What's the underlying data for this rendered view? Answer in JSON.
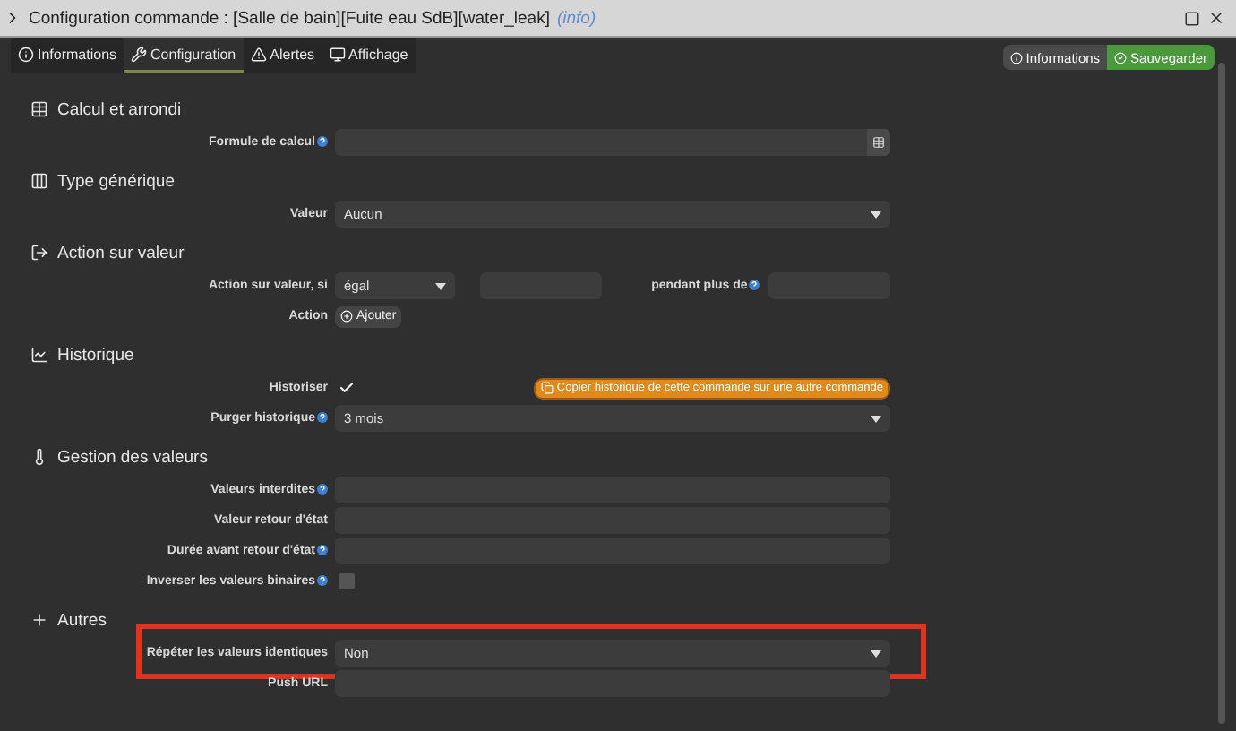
{
  "window": {
    "title": "Configuration commande : [Salle de bain][Fuite eau SdB][water_leak]",
    "title_note": "(info)"
  },
  "tabs": [
    {
      "label": "Informations",
      "selected": false
    },
    {
      "label": "Configuration",
      "selected": true
    },
    {
      "label": "Alertes",
      "selected": false
    },
    {
      "label": "Affichage",
      "selected": false
    }
  ],
  "actions": [
    {
      "label": "Informations",
      "kind": "info"
    },
    {
      "label": "Sauvegarder",
      "kind": "save"
    }
  ],
  "sections": [
    {
      "title": "Calcul et arrondi",
      "rows": [
        {
          "kind": "input",
          "label": "Formule de calcul",
          "help": true,
          "addon": true,
          "highlighted": false
        }
      ]
    },
    {
      "title": "Type générique",
      "rows": [
        {
          "kind": "select",
          "label": "Valeur",
          "help": false,
          "value": "Aucun",
          "highlighted": false
        }
      ]
    },
    {
      "title": "Action sur valeur",
      "rows": [
        {
          "kind": "condition",
          "label": "Action sur valeur, si",
          "help": false,
          "value": "égal",
          "second_label": "pendant plus de",
          "highlighted": false
        },
        {
          "kind": "button",
          "label": "Action",
          "help": false,
          "button": "Ajouter",
          "highlighted": false
        }
      ]
    },
    {
      "title": "Historique",
      "rows": [
        {
          "kind": "checkbox",
          "label": "Historiser",
          "help": false,
          "checked": true,
          "extra_button": "Copier historique de cette commande sur une autre commande",
          "highlighted": false
        },
        {
          "kind": "select",
          "label": "Purger historique",
          "help": true,
          "value": "3 mois",
          "highlighted": false
        }
      ]
    },
    {
      "title": "Gestion des valeurs",
      "rows": [
        {
          "kind": "input",
          "label": "Valeurs interdites",
          "help": true,
          "highlighted": false
        },
        {
          "kind": "input",
          "label": "Valeur retour d'état",
          "help": false,
          "highlighted": false
        },
        {
          "kind": "input",
          "label": "Durée avant retour d'état",
          "help": true,
          "highlighted": false
        },
        {
          "kind": "checkbox",
          "label": "Inverser les valeurs binaires",
          "help": true,
          "checked": false,
          "highlighted": false
        }
      ]
    },
    {
      "title": "Autres",
      "rows": [
        {
          "kind": "select",
          "label": "Répéter les valeurs identiques",
          "help": false,
          "value": "Non",
          "highlighted": true
        },
        {
          "kind": "input",
          "label": "Push URL",
          "help": false,
          "highlighted": false
        }
      ]
    }
  ]
}
